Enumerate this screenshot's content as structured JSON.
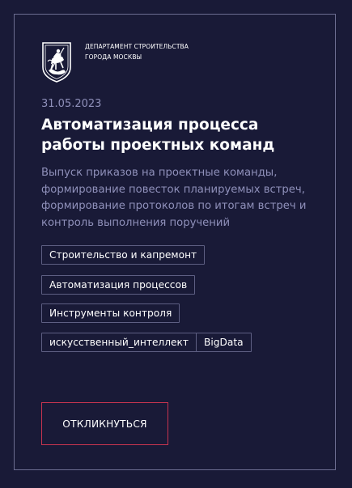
{
  "organization": {
    "line1": "ДЕПАРТАМЕНТ СТРОИТЕЛЬСТВА",
    "line2": "ГОРОДА МОСКВЫ",
    "logo_icon": "moscow-coat-of-arms-icon"
  },
  "card": {
    "date": "31.05.2023",
    "title": "Автоматизация процесса работы проектных команд",
    "description": "Выпуск приказов на проектные команды, формирование повесток планируемых встреч, формирование протоколов по итогам встреч и контроль выполнения поручений",
    "tags": [
      "Строительство и капремонт",
      "Автоматизация процессов",
      "Инструменты контроля",
      "искусственный_интеллект",
      "BigData"
    ],
    "cta_label": "ОТКЛИКНУТЬСЯ"
  },
  "colors": {
    "background": "#191a37",
    "border": "#6c6d91",
    "muted_text": "#8f90ba",
    "accent": "#c8344f"
  }
}
